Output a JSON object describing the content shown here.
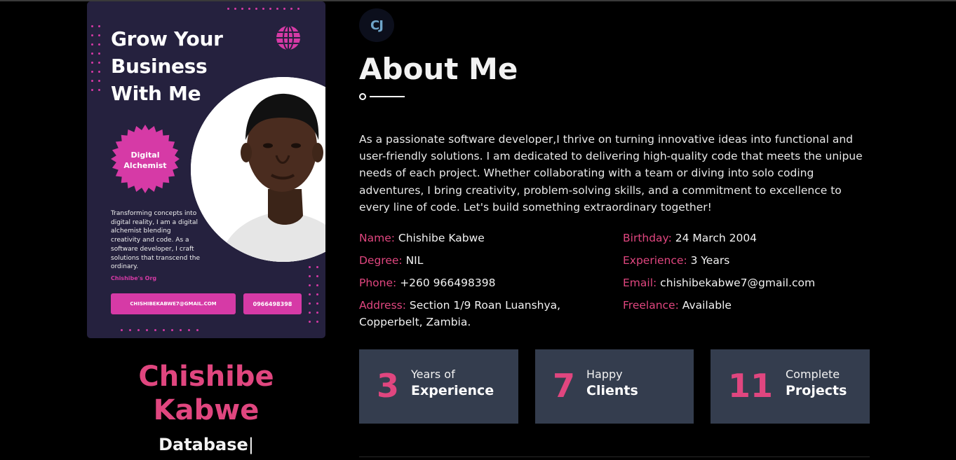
{
  "poster": {
    "title": "Grow Your Business With Me",
    "badge": "Digital Alchemist",
    "description": "Transforming concepts into digital reality, I am a digital alchemist blending creativity and code. As a software developer, I craft solutions that transcend the ordinary.",
    "org": "Chishibe's Org",
    "email_button": "CHISHIBEKABWE7@GMAIL.COM",
    "phone_button": "0966498398",
    "accent_color": "#d63aa6"
  },
  "profile": {
    "name": "Chishibe Kabwe",
    "typed_role": "Database",
    "cursor": "|"
  },
  "about": {
    "logo_text": "CJ",
    "title": "About Me",
    "text": "As a passionate software developer,I thrive on turning innovative ideas into functional and user-friendly solutions. I am dedicated to delivering high-quality code that meets the unipue needs of each project. Whether collaborating with a team or diving into solo coding adventures, I bring creativity, problem-solving skills, and a commitment to excellence to every line of code. Let's build something extraordinary together!"
  },
  "info": {
    "name_label": "Name:",
    "name_value": "Chishibe Kabwe",
    "degree_label": "Degree:",
    "degree_value": "NIL",
    "phone_label": "Phone:",
    "phone_value": "+260 966498398",
    "address_label": "Address:",
    "address_value": "Section 1/9 Roan Luanshya, Copperbelt, Zambia.",
    "birthday_label": "Birthday:",
    "birthday_value": "24 March 2004",
    "experience_label": "Experience:",
    "experience_value": "3 Years",
    "email_label": "Email:",
    "email_value": "chishibekabwe7@gmail.com",
    "freelance_label": "Freelance:",
    "freelance_value": "Available"
  },
  "stats": [
    {
      "number": "3",
      "line1": "Years of",
      "line2": "Experience"
    },
    {
      "number": "7",
      "line1": "Happy",
      "line2": "Clients"
    },
    {
      "number": "11",
      "line1": "Complete",
      "line2": "Projects"
    }
  ],
  "colors": {
    "accent": "#e0467f",
    "stat_bg": "#343d4e",
    "poster_bg": "#25213e"
  }
}
